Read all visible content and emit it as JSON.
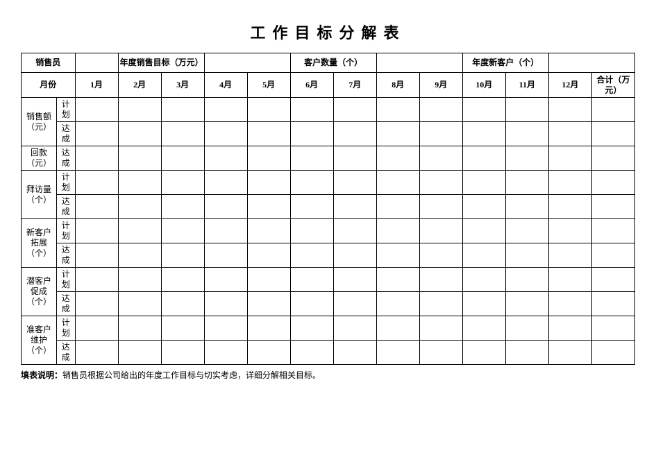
{
  "title": "工作目标分解表",
  "header": {
    "salesperson_label": "销售员",
    "annual_target_label": "年度销售目标（万元）",
    "customer_count_label": "客户数量（个）",
    "annual_new_customer_label": "年度新客户（个）"
  },
  "columns": {
    "month_label": "月份",
    "months": [
      "1月",
      "2月",
      "3月",
      "4月",
      "5月",
      "6月",
      "7月",
      "8月",
      "9月",
      "10月",
      "11月",
      "12月"
    ],
    "total_label": "合计（万元）"
  },
  "row_sub": {
    "plan": "计划",
    "achieved": "达成"
  },
  "rows": [
    {
      "label": "销售额（元）"
    },
    {
      "label": "回款（元）"
    },
    {
      "label": "拜访量（个）"
    },
    {
      "label": "新客户拓展（个）"
    },
    {
      "label": "潜客户促成（个）"
    },
    {
      "label": "准客户维护（个）"
    }
  ],
  "footer": {
    "label": "填表说明：",
    "text": "销售员根据公司给出的年度工作目标与切实考虑，详细分解相关目标。"
  }
}
